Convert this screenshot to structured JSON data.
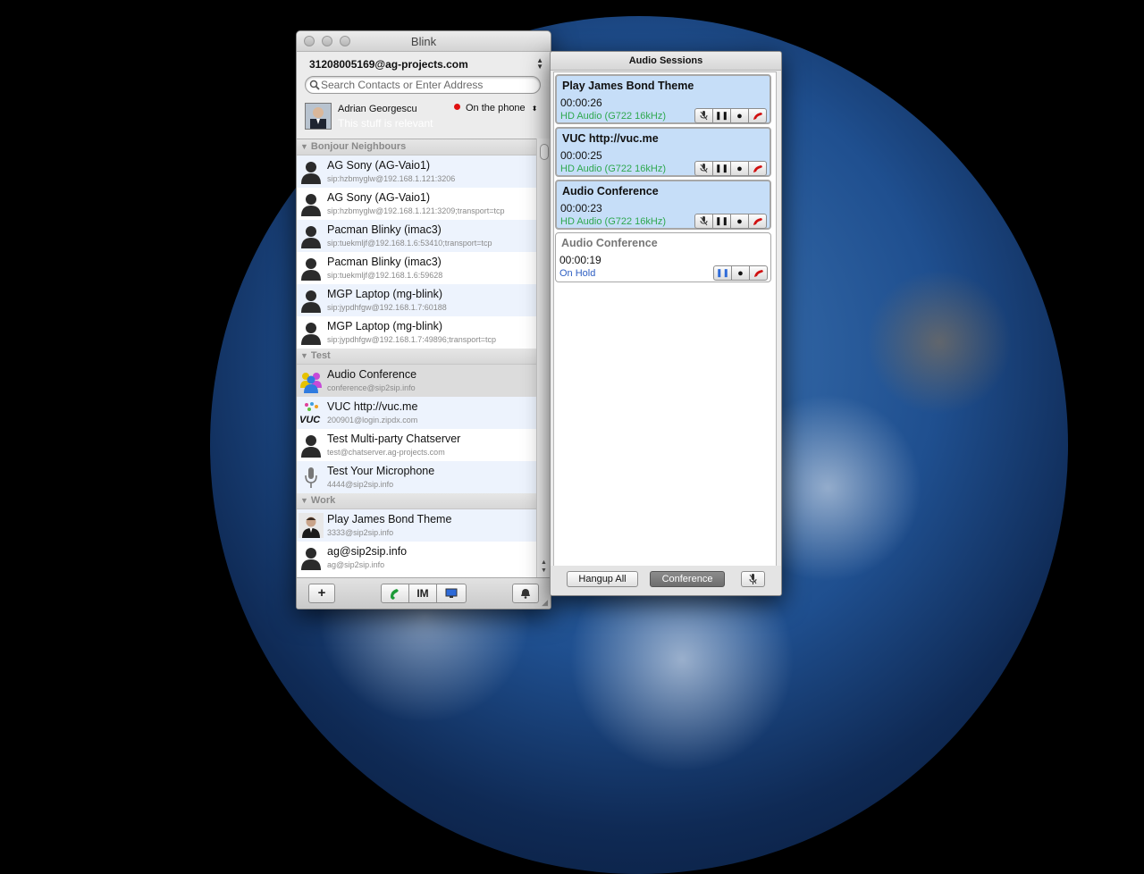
{
  "desktop": {
    "background": "earth-from-space"
  },
  "blink": {
    "title": "Blink",
    "account": "31208005169@ag-projects.com",
    "search_placeholder": "Search Contacts or Enter Address",
    "me": {
      "name": "Adrian Georgescu",
      "note": "This stuff is relevant",
      "presence": "On the phone",
      "presence_color": "#e01010"
    },
    "groups": [
      {
        "name": "Bonjour Neighbours",
        "contacts": [
          {
            "name": "AG Sony (AG-Vaio1)",
            "uri": "sip:hzbmyglw@192.168.1.121:3206",
            "icon": "person-silhouette-icon"
          },
          {
            "name": "AG Sony (AG-Vaio1)",
            "uri": "sip:hzbmyglw@192.168.1.121:3209;transport=tcp",
            "icon": "person-silhouette-icon"
          },
          {
            "name": "Pacman Blinky (imac3)",
            "uri": "sip:tuekmljf@192.168.1.6:53410;transport=tcp",
            "icon": "person-silhouette-icon"
          },
          {
            "name": "Pacman Blinky (imac3)",
            "uri": "sip:tuekmljf@192.168.1.6:59628",
            "icon": "person-silhouette-icon"
          },
          {
            "name": "MGP Laptop (mg-blink)",
            "uri": "sip:jypdhfgw@192.168.1.7:60188",
            "icon": "person-silhouette-icon"
          },
          {
            "name": "MGP Laptop (mg-blink)",
            "uri": "sip:jypdhfgw@192.168.1.7:49896;transport=tcp",
            "icon": "person-silhouette-icon"
          }
        ]
      },
      {
        "name": "Test",
        "contacts": [
          {
            "name": "Audio Conference",
            "uri": "conference@sip2sip.info",
            "icon": "conference-people-icon"
          },
          {
            "name": "VUC http://vuc.me",
            "uri": "200901@login.zipdx.com",
            "icon": "vuc-logo-icon",
            "logo_text": "VUC"
          },
          {
            "name": "Test Multi-party Chatserver",
            "uri": "test@chatserver.ag-projects.com",
            "icon": "person-silhouette-icon"
          },
          {
            "name": "Test Your Microphone",
            "uri": "4444@sip2sip.info",
            "icon": "microphone-icon"
          }
        ]
      },
      {
        "name": "Work",
        "contacts": [
          {
            "name": "Play James Bond Theme",
            "uri": "3333@sip2sip.info",
            "icon": "james-bond-photo-icon"
          },
          {
            "name": "ag@sip2sip.info",
            "uri": "ag@sip2sip.info",
            "icon": "person-silhouette-icon"
          }
        ]
      }
    ],
    "toolbar": {
      "add": "+",
      "im": "IM"
    }
  },
  "audio": {
    "title": "Audio Sessions",
    "sessions": [
      {
        "title": "Play James Bond Theme",
        "time": "00:00:26",
        "status": "HD Audio (G722 16kHz)",
        "state": "active"
      },
      {
        "title": "VUC http://vuc.me",
        "time": "00:00:25",
        "status": "HD Audio (G722 16kHz)",
        "state": "active"
      },
      {
        "title": "Audio Conference",
        "time": "00:00:23",
        "status": "HD Audio (G722 16kHz)",
        "state": "active"
      },
      {
        "title": "Audio Conference",
        "time": "00:00:19",
        "status": "On Hold",
        "state": "held"
      }
    ],
    "hangup_all": "Hangup All",
    "conference": "Conference",
    "colors": {
      "hd_audio": "#2fa84f",
      "on_hold": "#2d5ec2",
      "active_bg": "#c6def8",
      "hangup": "#d01010"
    }
  }
}
